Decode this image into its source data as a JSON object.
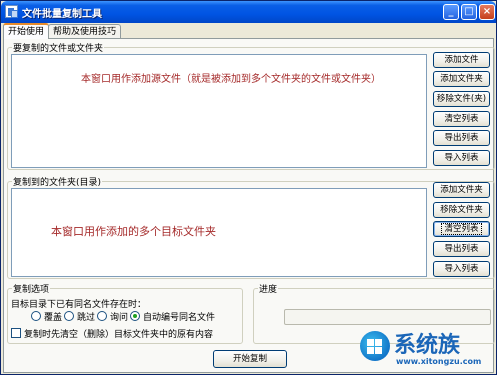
{
  "window": {
    "title": "文件批量复制工具"
  },
  "title_buttons": {
    "minimize": "_",
    "maximize": "□",
    "close": "×"
  },
  "tabs": [
    {
      "label": "开始使用",
      "active": true
    },
    {
      "label": "帮助及使用技巧",
      "active": false
    }
  ],
  "source_group": {
    "label": "要复制的文件或文件夹",
    "hint": "本窗口用作添加源文件（就是被添加到多个文件夹的文件或文件夹）",
    "buttons": [
      "添加文件",
      "添加文件夹",
      "移除文件(夹)",
      "清空列表",
      "导出列表",
      "导入列表"
    ]
  },
  "target_group": {
    "label": "复制到的文件夹(目录)",
    "hint": "本窗口用作添加的多个目标文件夹",
    "buttons": [
      "添加文件夹",
      "移除文件夹",
      "清空列表",
      "导出列表",
      "导入列表"
    ]
  },
  "options_group": {
    "label": "复制选项",
    "conflict_label": "目标目录下已有同名文件存在时：",
    "radios": [
      {
        "label": "覆盖",
        "checked": false
      },
      {
        "label": "跳过",
        "checked": false
      },
      {
        "label": "询问",
        "checked": false
      },
      {
        "label": "自动编号同名文件",
        "checked": true
      }
    ],
    "clear_checkbox": {
      "label": "复制时先清空（删除）目标文件夹中的原有内容",
      "checked": false
    }
  },
  "progress_group": {
    "label": "进度",
    "value": 0
  },
  "start_button": "开始复制",
  "watermark": {
    "name": "系统族",
    "url": "www.xitongzu.com"
  }
}
